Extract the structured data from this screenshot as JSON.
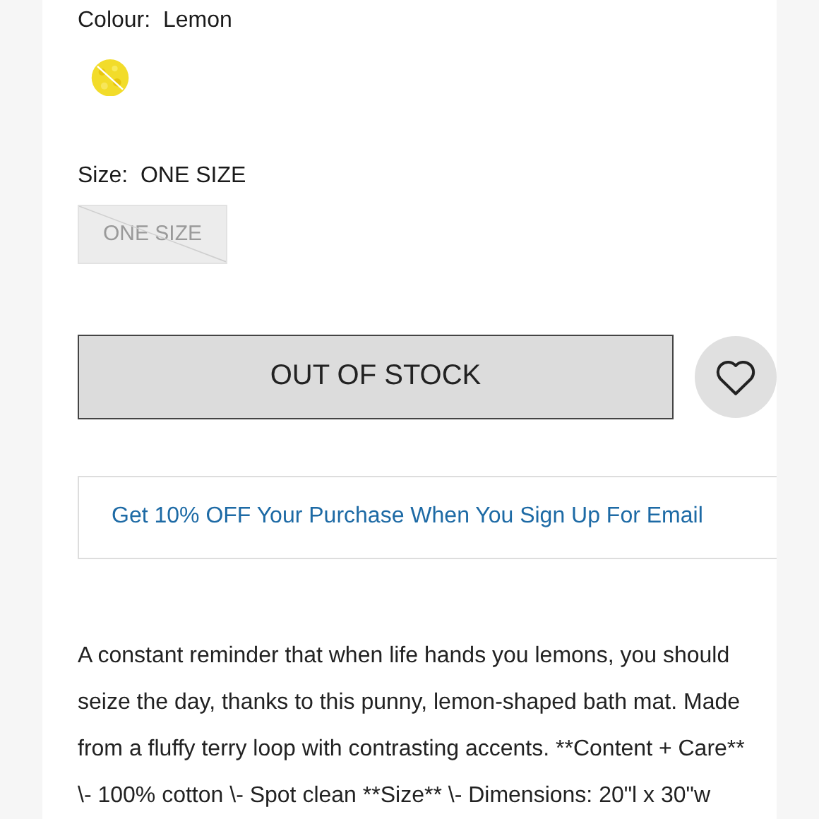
{
  "colour": {
    "label": "Colour:",
    "value": "Lemon"
  },
  "size": {
    "label": "Size:",
    "value": "ONE SIZE",
    "options": [
      {
        "label": "ONE SIZE",
        "available": false
      }
    ]
  },
  "stock_button": {
    "label": "OUT OF STOCK",
    "disabled": true
  },
  "promo": {
    "text": "Get 10% OFF Your Purchase When You Sign Up For Email"
  },
  "description": "A constant reminder that when life hands you lemons, you should seize the day, thanks to this punny, lemon-shaped bath mat. Made from a fluffy terry loop with contrasting accents. **Content + Care** \\- 100% cotton \\- Spot clean **Size** \\- Dimensions: 20\"l x 30\"w"
}
